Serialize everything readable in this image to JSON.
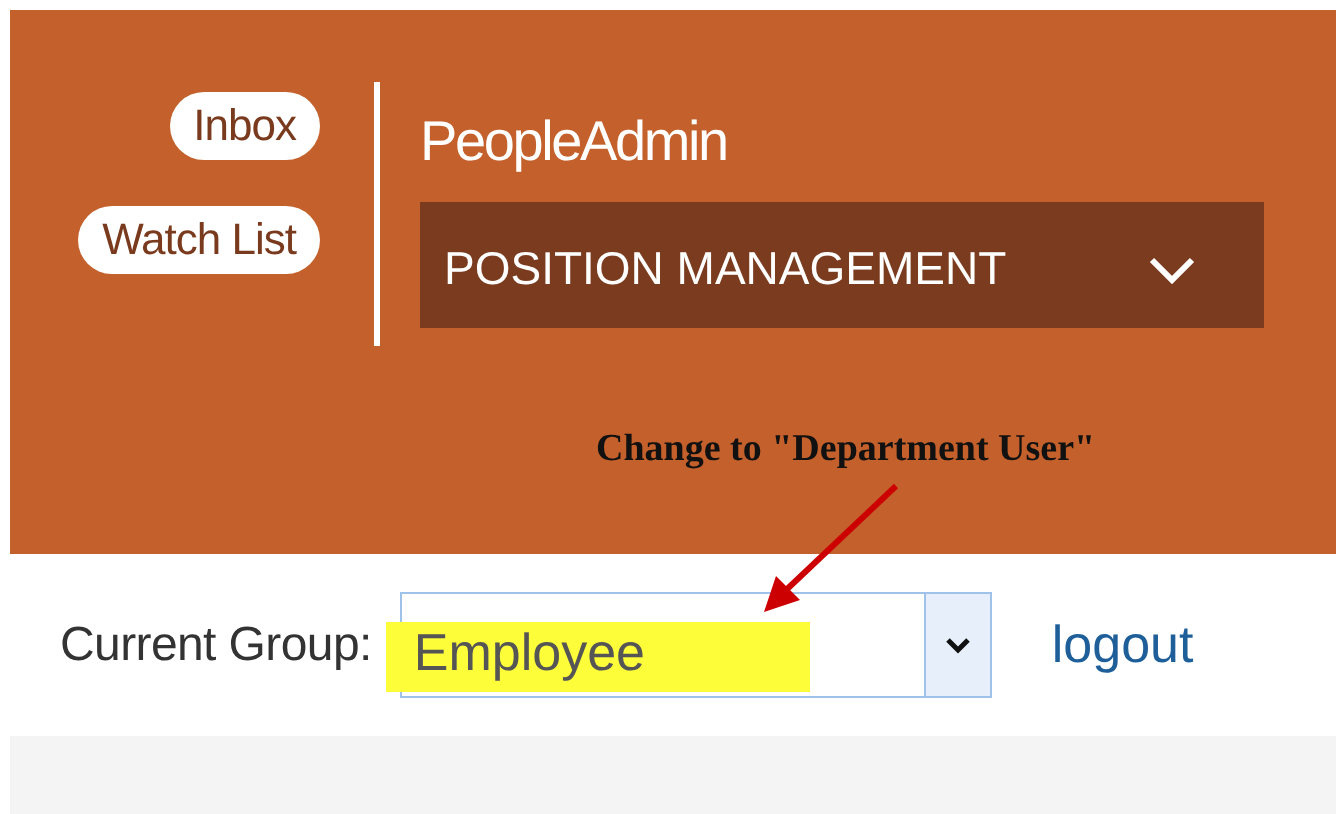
{
  "header": {
    "links": [
      "Inbox",
      "Watch List"
    ],
    "brand": "PeopleAdmin",
    "module_menu": {
      "label": "POSITION MANAGEMENT"
    }
  },
  "annotation": {
    "text": "Change to \"Department User\""
  },
  "group_bar": {
    "label": "Current Group:",
    "select": {
      "value": "Employee",
      "highlighted": true
    },
    "logout": "logout"
  }
}
